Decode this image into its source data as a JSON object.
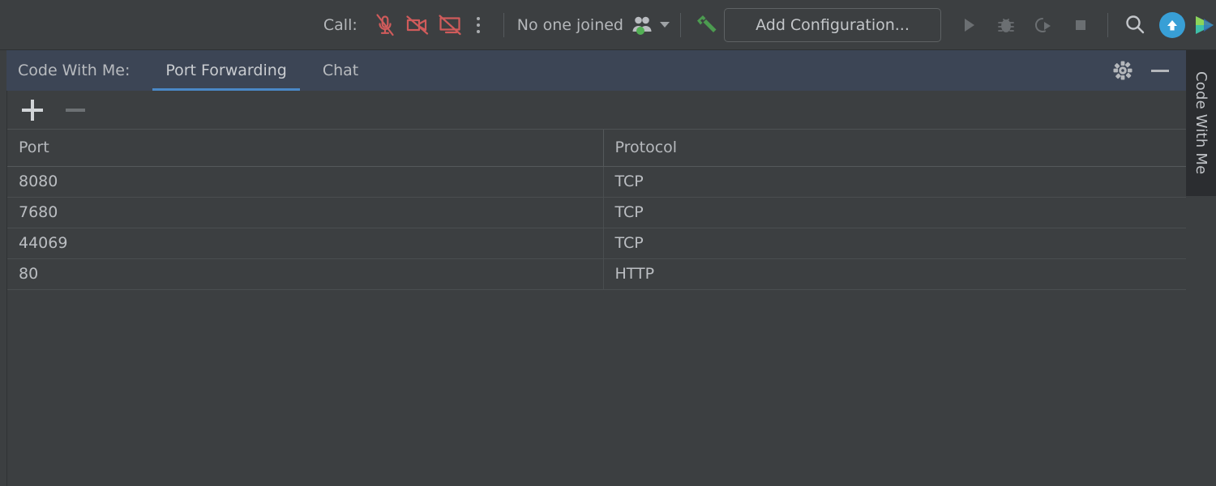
{
  "toolbar": {
    "call_label": "Call:",
    "mic_icon": "microphone-off-icon",
    "camera_icon": "camera-off-icon",
    "screenshare_icon": "screen-share-off-icon",
    "more_icon": "more-vertical-icon",
    "joined_status": "No one joined",
    "people_icon": "people-online-icon",
    "people_caret_icon": "chevron-down-icon",
    "build_icon": "hammer-build-icon",
    "add_configuration_label": "Add Configuration...",
    "run_icon": "run-play-icon",
    "debug_icon": "debug-bug-icon",
    "run_coverage_icon": "run-with-coverage-icon",
    "stop_icon": "stop-square-icon",
    "search_icon": "search-icon",
    "update_icon": "update-arrow-up-icon",
    "ide_logo_icon": "ide-logo-icon",
    "colors": {
      "muted_red": "#d05b5b",
      "build_green": "#4c9b50",
      "accent_blue": "#389fd6",
      "presence_green": "#52b054"
    }
  },
  "tool_window": {
    "title": "Code With Me:",
    "tabs": [
      {
        "label": "Port Forwarding",
        "active": true
      },
      {
        "label": "Chat",
        "active": false
      }
    ],
    "settings_icon": "gear-icon",
    "hide_icon": "minimize-icon",
    "active_tab_underline_color": "#4a88c7"
  },
  "side_strip": {
    "label": "Code With Me",
    "icon": "vertical-tool-window-tab"
  },
  "panel": {
    "toolbar": {
      "add_icon": "plus-icon",
      "remove_icon": "minus-icon",
      "add_enabled": true,
      "remove_enabled": false
    },
    "table": {
      "columns": [
        "Port",
        "Protocol"
      ],
      "rows": [
        {
          "port": "8080",
          "protocol": "TCP"
        },
        {
          "port": "7680",
          "protocol": "TCP"
        },
        {
          "port": "44069",
          "protocol": "TCP"
        },
        {
          "port": "80",
          "protocol": "HTTP"
        }
      ]
    }
  }
}
